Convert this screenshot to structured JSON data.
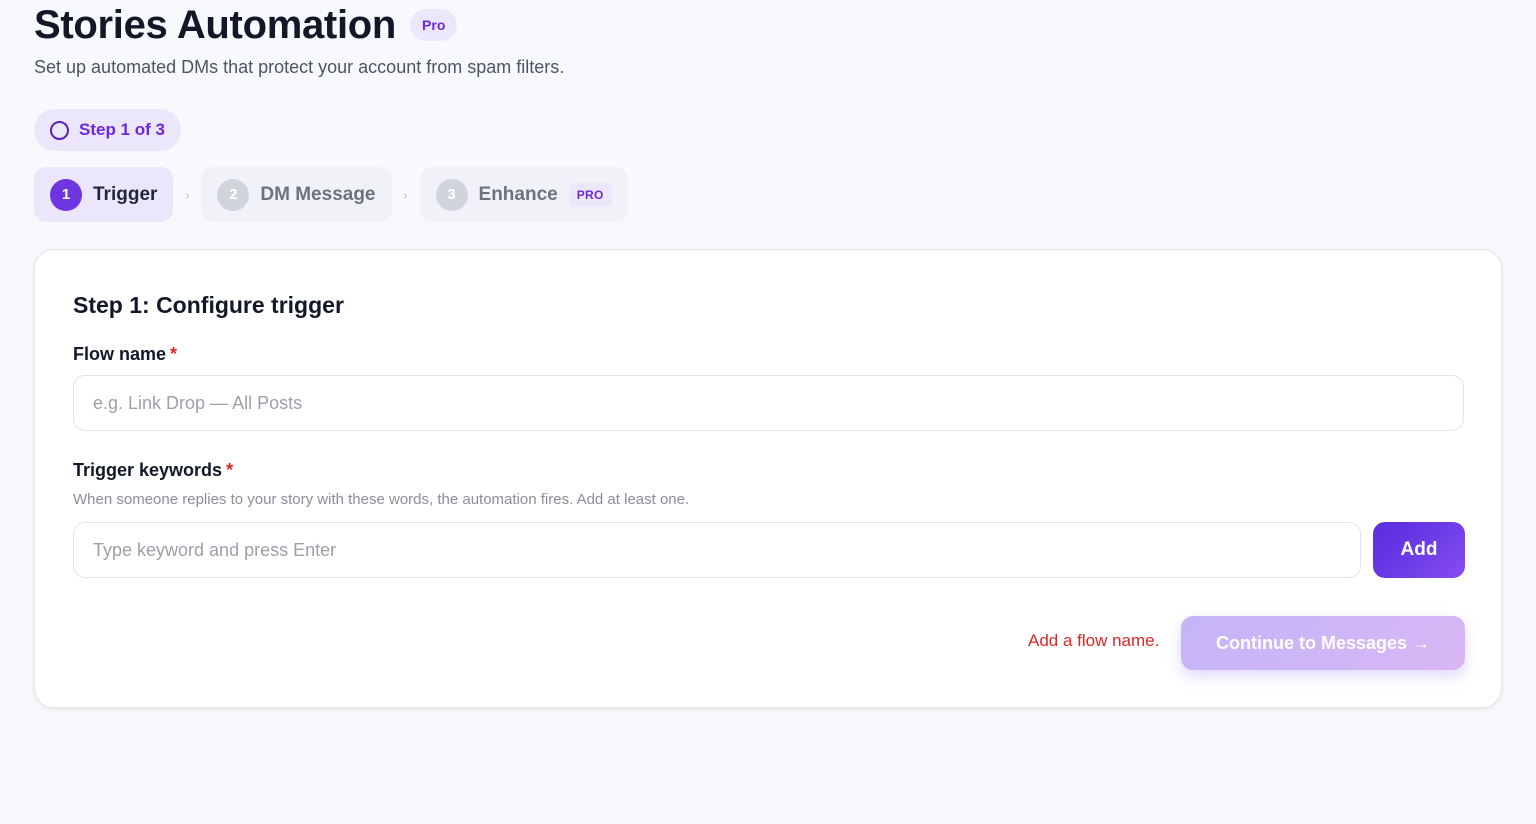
{
  "header": {
    "title": "Stories Automation",
    "badge": "Pro",
    "subtitle": "Set up automated DMs that protect your account from spam filters."
  },
  "progress": {
    "label": "Step 1 of 3",
    "current": 1,
    "total": 3
  },
  "stepper": {
    "steps": [
      {
        "number": "1",
        "label": "Trigger",
        "active": true
      },
      {
        "number": "2",
        "label": "DM Message",
        "active": false
      },
      {
        "number": "3",
        "label": "Enhance",
        "active": false,
        "badge": "PRO"
      }
    ],
    "separator": "›"
  },
  "form": {
    "title": "Step 1: Configure trigger",
    "required_mark": "*",
    "flow_name": {
      "label": "Flow name",
      "value": "",
      "placeholder": "e.g. Link Drop — All Posts"
    },
    "keywords": {
      "label": "Trigger keywords",
      "help": "When someone replies to your story with these words, the automation fires. Add at least one.",
      "value": "",
      "placeholder": "Type keyword and press Enter",
      "add_label": "Add"
    },
    "error": "Add a flow name.",
    "continue_label": "Continue to Messages →"
  },
  "colors": {
    "accent": "#6d35e0",
    "accent_light": "#ebe6fb",
    "error": "#dc2626",
    "background": "#f8f9fc"
  }
}
